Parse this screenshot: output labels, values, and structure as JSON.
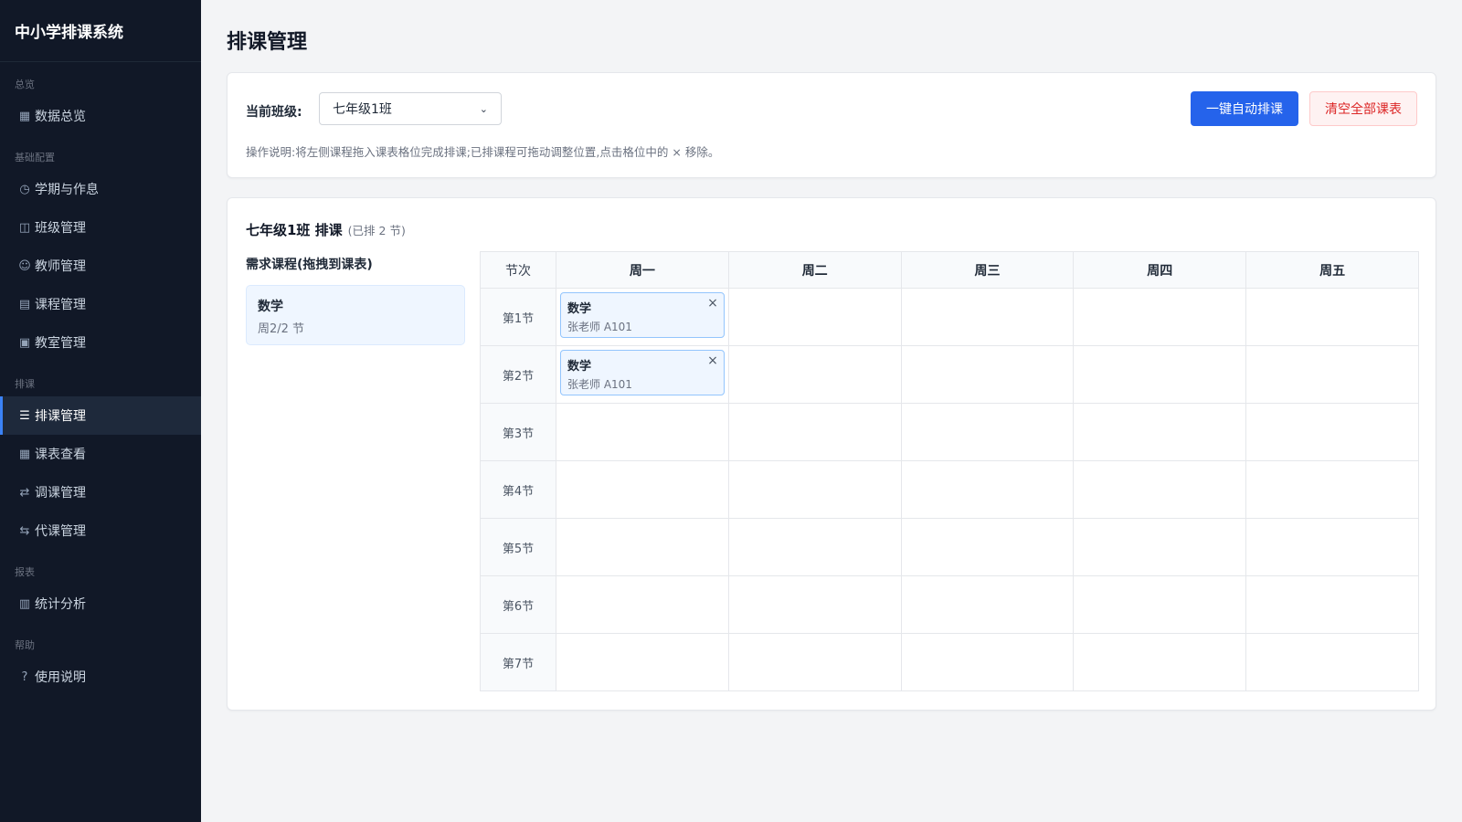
{
  "app": {
    "title": "中小学排课系统"
  },
  "sidebar": {
    "groups": [
      {
        "title": "总览",
        "items": [
          {
            "icon": "▦",
            "label": "数据总览"
          }
        ]
      },
      {
        "title": "基础配置",
        "items": [
          {
            "icon": "◷",
            "label": "学期与作息"
          },
          {
            "icon": "◫",
            "label": "班级管理"
          },
          {
            "icon": "☺",
            "label": "教师管理"
          },
          {
            "icon": "▤",
            "label": "课程管理"
          },
          {
            "icon": "▣",
            "label": "教室管理"
          }
        ]
      },
      {
        "title": "排课",
        "items": [
          {
            "icon": "☰",
            "label": "排课管理",
            "active": true
          },
          {
            "icon": "▦",
            "label": "课表查看"
          },
          {
            "icon": "⇄",
            "label": "调课管理"
          },
          {
            "icon": "⇆",
            "label": "代课管理"
          }
        ]
      },
      {
        "title": "报表",
        "items": [
          {
            "icon": "▥",
            "label": "统计分析"
          }
        ]
      },
      {
        "title": "帮助",
        "items": [
          {
            "icon": "?",
            "label": "使用说明"
          }
        ]
      }
    ]
  },
  "page": {
    "title": "排课管理"
  },
  "toolbar": {
    "class_label": "当前班级:",
    "class_selected": "七年级1班",
    "auto_button": "一键自动排课",
    "clear_button": "清空全部课表",
    "hint": "操作说明:将左侧课程拖入课表格位完成排课;已排课程可拖动调整位置,点击格位中的 × 移除。"
  },
  "schedule": {
    "title": "七年级1班 排课",
    "count": "(已排 2 节)",
    "requirements_title": "需求课程(拖拽到课表)",
    "requirements": [
      {
        "name": "数学",
        "detail": "周2/2 节"
      }
    ],
    "period_header": "节次",
    "days": [
      "周一",
      "周二",
      "周三",
      "周四",
      "周五"
    ],
    "periods": [
      "第1节",
      "第2节",
      "第3节",
      "第4节",
      "第5节",
      "第6节",
      "第7节"
    ],
    "lessons": [
      {
        "period": 0,
        "day": 0,
        "name": "数学",
        "detail": "张老师 A101",
        "remove": "×"
      },
      {
        "period": 1,
        "day": 0,
        "name": "数学",
        "detail": "张老师 A101",
        "remove": "×"
      }
    ]
  },
  "colors": {
    "primary": "#2563eb",
    "danger": "#dc2626",
    "sidebar_bg": "#111827"
  }
}
